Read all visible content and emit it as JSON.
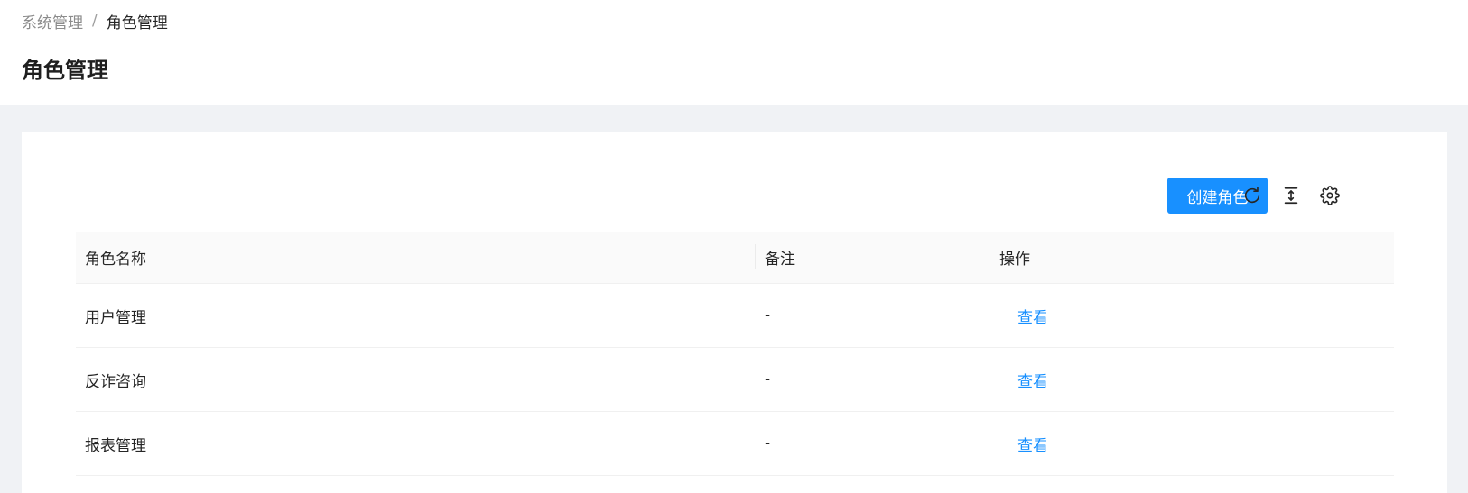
{
  "breadcrumb": {
    "parent": "系统管理",
    "separator": "/",
    "current": "角色管理"
  },
  "page_title": "角色管理",
  "toolbar": {
    "create_label": "创建角色",
    "icons": [
      "refresh-icon",
      "column-height-icon",
      "settings-icon"
    ]
  },
  "table": {
    "columns": [
      "角色名称",
      "备注",
      "操作"
    ],
    "rows": [
      {
        "name": "用户管理",
        "note": "-",
        "action": "查看"
      },
      {
        "name": "反诈咨询",
        "note": "-",
        "action": "查看"
      },
      {
        "name": "报表管理",
        "note": "-",
        "action": "查看"
      }
    ]
  },
  "colors": {
    "primary": "#1890ff",
    "background": "#f0f2f5",
    "header_bg": "#fafafa"
  }
}
